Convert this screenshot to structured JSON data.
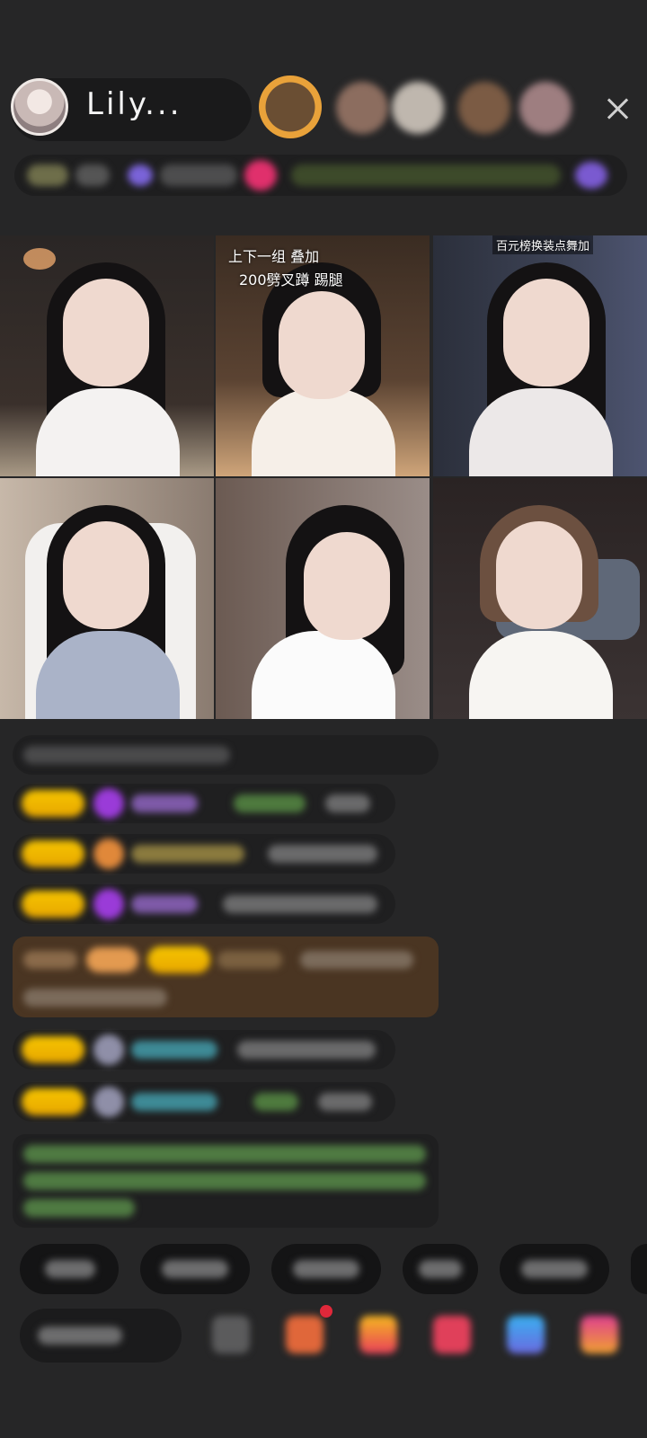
{
  "header": {
    "host_name": "Lily...",
    "fan_avatars": [
      "fan-avatar-1",
      "fan-avatar-2",
      "fan-avatar-3",
      "fan-avatar-4",
      "fan-avatar-5"
    ],
    "close_icon": "close-icon"
  },
  "video_grid": {
    "cells": [
      {
        "caption": ""
      },
      {
        "caption_line1": "上下一组 叠加",
        "caption_line2": "200劈叉蹲 踢腿"
      },
      {
        "caption": "百元榜换装点舞加"
      },
      {
        "caption": ""
      },
      {
        "caption": ""
      },
      {
        "caption": ""
      }
    ]
  },
  "colors": {
    "background": "#262627",
    "badge_gold": "#f0b800",
    "chat_green": "#6fa85a",
    "chat_cyan": "#4fb3c2",
    "chat_purple": "#a06bd6"
  }
}
